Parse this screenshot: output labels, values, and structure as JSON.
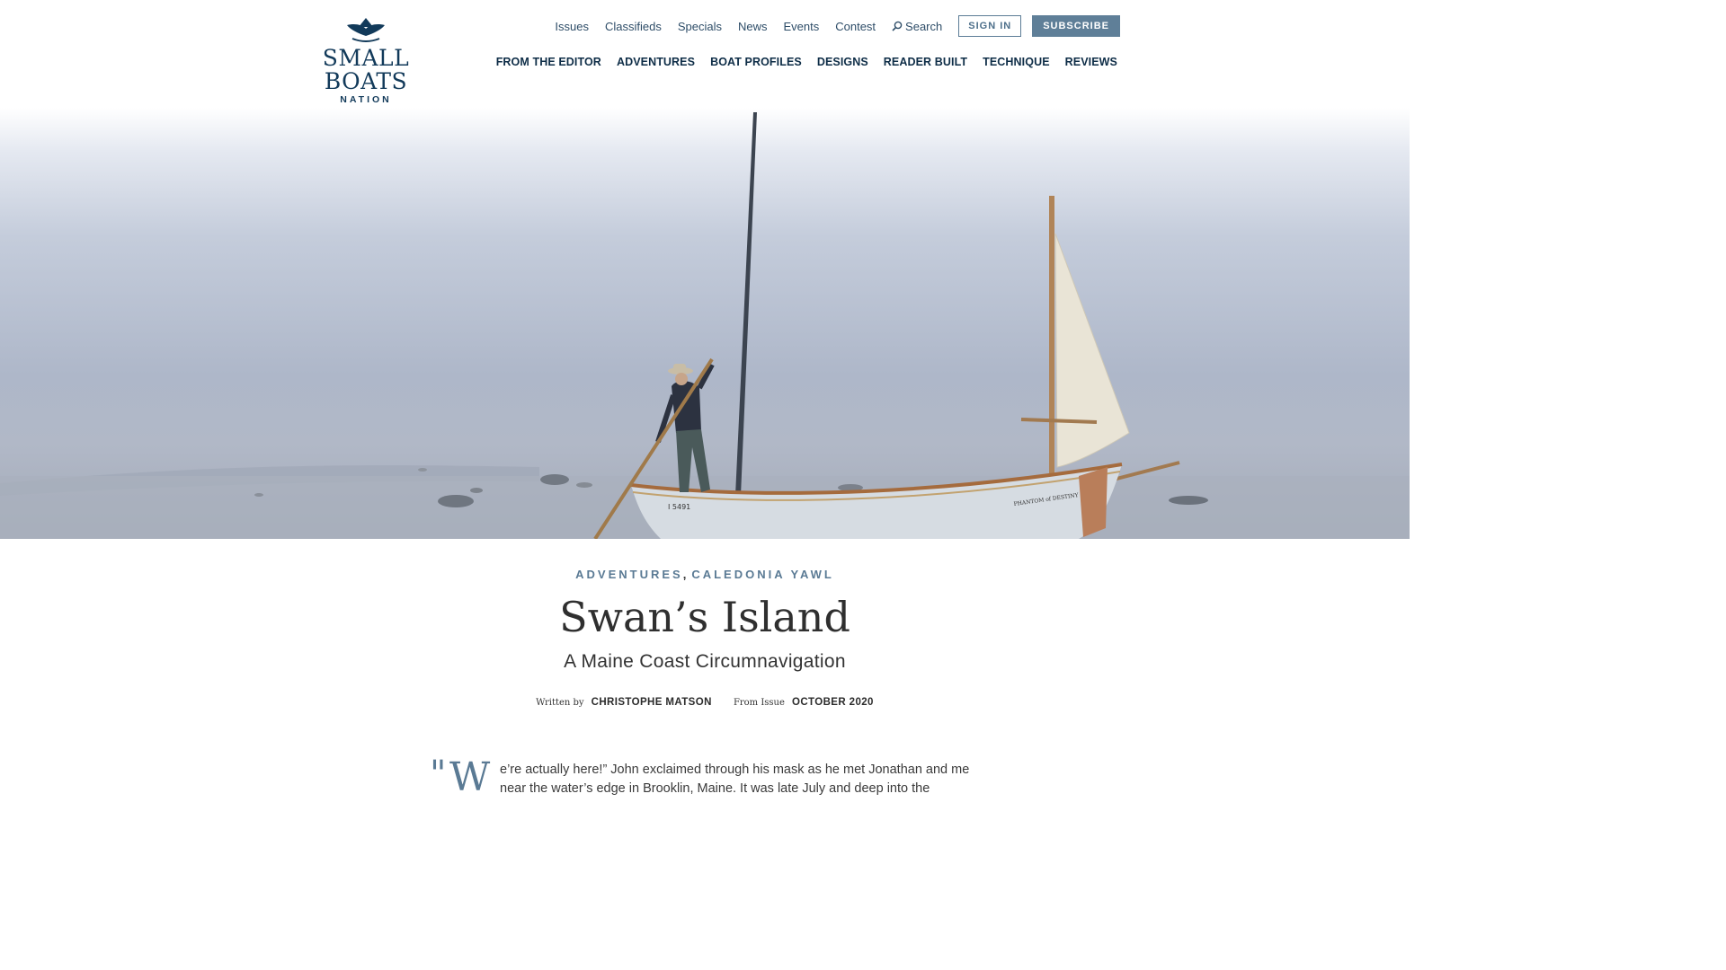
{
  "site": {
    "logo_name": "SMALL BOATS",
    "logo_sub": "NATION",
    "brand_color": "#123a5a",
    "accent_color": "#5f7f98"
  },
  "utility_nav": {
    "items": [
      "Issues",
      "Classifieds",
      "Specials",
      "News",
      "Events",
      "Contest"
    ],
    "search_label": "Search",
    "signin_label": "SIGN IN",
    "subscribe_label": "SUBSCRIBE"
  },
  "main_nav": {
    "items": [
      "FROM THE EDITOR",
      "ADVENTURES",
      "BOAT PROFILES",
      "DESIGNS",
      "READER BUILT",
      "TECHNIQUE",
      "REVIEWS"
    ]
  },
  "hero": {
    "icon": "photo-fog-sailboat",
    "transom_name": "I 5491",
    "hull_name": "PHANTOM of DESTINY"
  },
  "article": {
    "categories": [
      "ADVENTURES",
      "CALEDONIA YAWL"
    ],
    "category_separator": ",",
    "title": "Swan’s Island",
    "subtitle": "A Maine Coast Circumnavigation",
    "written_by_label": "Written by",
    "author": "CHRISTOPHE MATSON",
    "from_issue_label": "From Issue",
    "issue": "OCTOBER 2020",
    "dropquote": "\"",
    "dropcap": "W",
    "body_line_1": "e’re actually here!” John exclaimed through his mask as he met Jonathan and me",
    "body_line_2": "near the water’s edge in Brooklin, Maine. It was late July and deep into the"
  }
}
